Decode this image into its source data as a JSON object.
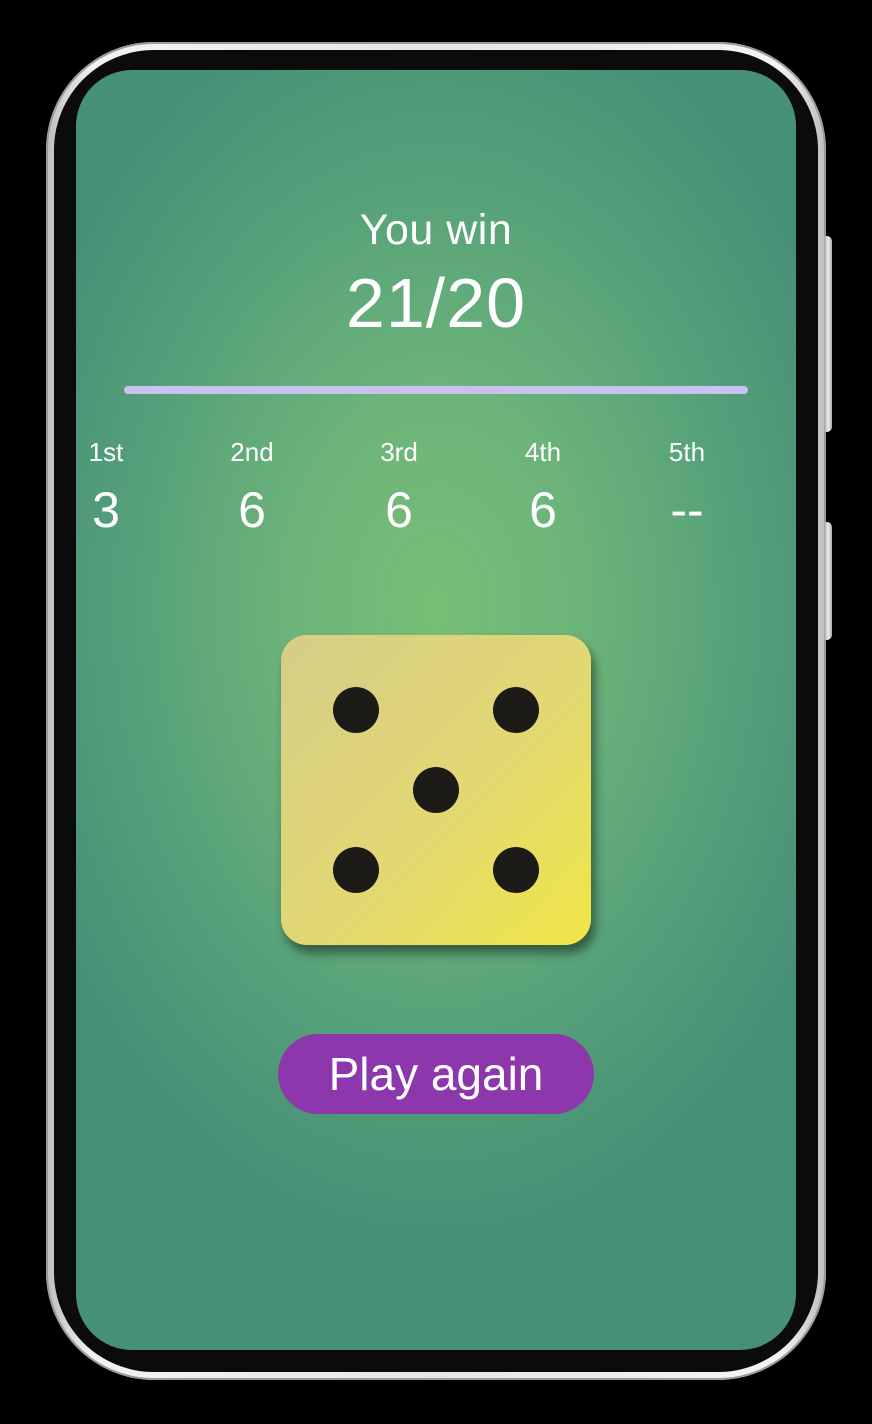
{
  "result": {
    "label": "You win",
    "score": "21/20",
    "progress": 1.0
  },
  "rolls": [
    {
      "label": "1st",
      "value": "3"
    },
    {
      "label": "2nd",
      "value": "6"
    },
    {
      "label": "3rd",
      "value": "6"
    },
    {
      "label": "4th",
      "value": "6"
    },
    {
      "label": "5th",
      "value": "--"
    }
  ],
  "die": {
    "face": 5,
    "pip_color": "#1c1a17"
  },
  "actions": {
    "play_again_label": "Play again"
  },
  "colors": {
    "accent_button": "#8d37ad",
    "progress_fill": "#c7c3ee",
    "background_center": "#79be76",
    "background_edge": "#468f78"
  }
}
